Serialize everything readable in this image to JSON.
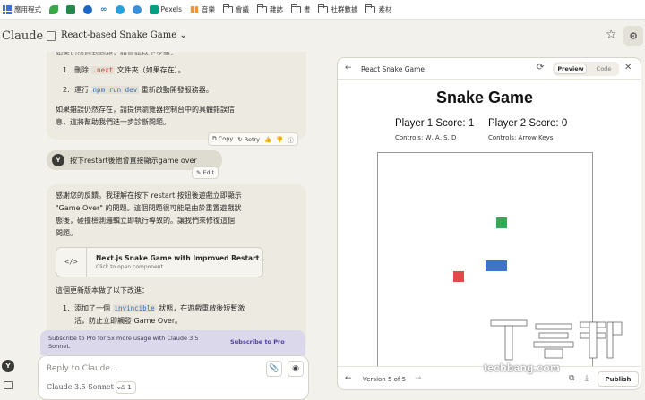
{
  "bookmarks": [
    {
      "label": "應用程式",
      "icon": "apps-grid-icon",
      "color": "#3d6fd8"
    },
    {
      "label": "",
      "icon": "green-leaf-icon",
      "color": "#3aa847"
    },
    {
      "label": "",
      "icon": "google-sheets-icon",
      "color": "#1f8a4c"
    },
    {
      "label": "",
      "icon": "c-circle-icon",
      "color": "#1b67c9"
    },
    {
      "label": "",
      "icon": "meta-icon",
      "color": "#1877f2"
    },
    {
      "label": "",
      "icon": "telegram-icon",
      "color": "#29a0dc"
    },
    {
      "label": "",
      "icon": "refresh-g-icon",
      "color": "#3b8fd9"
    },
    {
      "label": "Pexels",
      "icon": "pexels-icon",
      "color": "#05a081"
    },
    {
      "label": "音樂",
      "icon": "music-icon",
      "color": "#f09433"
    },
    {
      "label": "會議",
      "icon": "folder-icon"
    },
    {
      "label": "雜誌",
      "icon": "folder-icon"
    },
    {
      "label": "書",
      "icon": "folder-icon"
    },
    {
      "label": "社群數據",
      "icon": "folder-icon"
    },
    {
      "label": "素材",
      "icon": "folder-icon"
    }
  ],
  "header": {
    "logo": "Claude",
    "project_title": "React-based Snake Game ⌄"
  },
  "chat": {
    "msg1_line0": "如果仍然遇到問題，請嘗試以下步驟：",
    "msg1_step1_num": "1.",
    "msg1_step1_a": "刪除 ",
    "msg1_step1_code": ".next",
    "msg1_step1_b": " 文件夾（如果存在）。",
    "msg1_step2_num": "2.",
    "msg1_step2_a": "運行 ",
    "msg1_step2_code": "npm run dev",
    "msg1_step2_b": " 重新啟動開發服務器。",
    "msg1_tail1": "如果錯誤仍然存在，請提供瀏覽器控制台中的具體錯誤信",
    "msg1_tail2": "息，這將幫助我們進一步診斷問題。",
    "copy": "Copy",
    "retry": "Retry",
    "user_avatar": "Y",
    "user_msg": "按下restart後他會直接顯示game over",
    "edit": "Edit",
    "msg2_line1": "感謝您的反饋。我理解在按下 restart 按鈕後遊戲立即顯示",
    "msg2_line2": "\"Game Over\" 的問題。這個問題很可能是由於重置遊戲狀",
    "msg2_line3": "態後，碰撞檢測邏輯立即執行導致的。讓我們來修復這個",
    "msg2_line4": "問題。",
    "artifact_title": "Next.js Snake Game with Improved Restart",
    "artifact_sub": "Click to open component",
    "msg2_after": "這個更新版本做了以下改進：",
    "msg2_step1_num": "1.",
    "msg2_step1_a": "添加了一個 ",
    "msg2_step1_code": "invincible",
    "msg2_step1_b": " 狀態，在遊戲重啟後短暫激",
    "msg2_step1_c": "活，防止立即觸發 Game Over。"
  },
  "promo": {
    "text": "Subscribe to Pro for 5x more usage with Claude 3.5 Sonnet.",
    "link": "Subscribe to Pro"
  },
  "input": {
    "placeholder": "Reply to Claude...",
    "model": "Claude 3.5 Sonnet ⌄",
    "style_count": "1"
  },
  "panel": {
    "title": "React Snake Game",
    "tab_preview": "Preview",
    "tab_code": "Code",
    "version": "Version 5 of 5",
    "publish": "Publish"
  },
  "game": {
    "title": "Snake Game",
    "player1_score_label": "Player 1 Score: 1",
    "player2_score_label": "Player 2 Score: 0",
    "player1_controls": "Controls: W, A, S, D",
    "player2_controls": "Controls: Arrow Keys",
    "player1_score": 1,
    "player2_score": 0,
    "colors": {
      "food": "#33aa55",
      "player1": "#e04a4a",
      "player2": "#3d75c8"
    }
  },
  "watermark": {
    "text": "techbang.com"
  },
  "colors": {
    "background": "#f3f1eb",
    "promo_bg": "#dcd8ec",
    "promo_link": "#4d3fa8"
  }
}
